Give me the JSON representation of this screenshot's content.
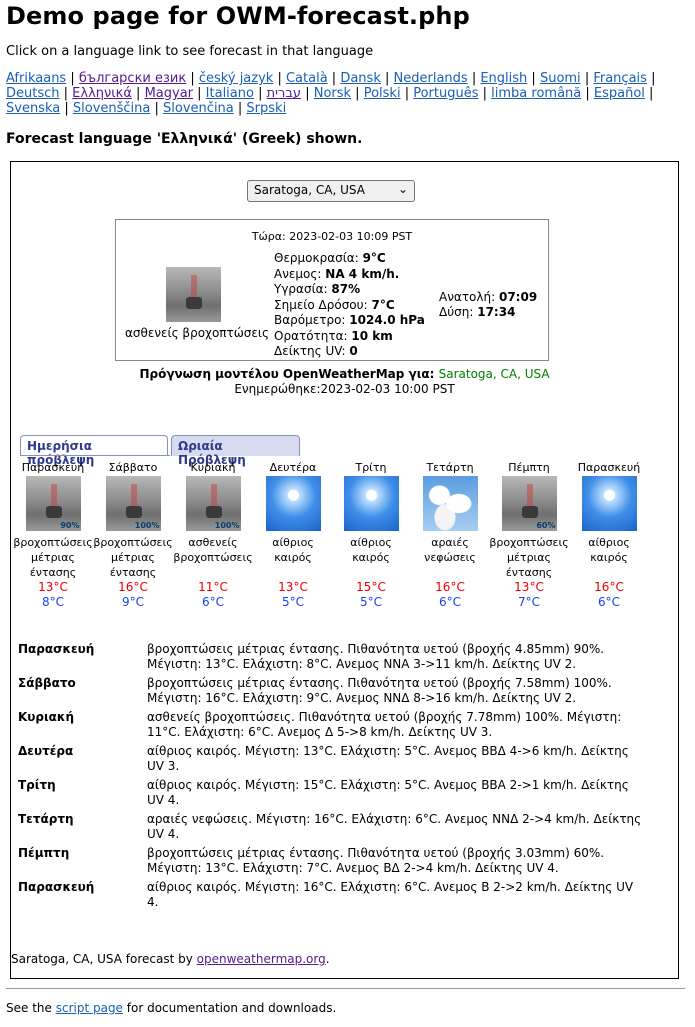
{
  "title": "Demo page for OWM-forecast.php",
  "intro": "Click on a language link to see forecast in that language",
  "languages": [
    "Afrikaans",
    "български език",
    "český jazyk",
    "Català",
    "Dansk",
    "Nederlands",
    "English",
    "Suomi",
    "Français",
    "Deutsch",
    "Ελληνικά",
    "Magyar",
    "Italiano",
    "עברית",
    "Norsk",
    "Polski",
    "Português",
    "limba română",
    "Español",
    "Svenska",
    "Slovenščina",
    "Slovenčina",
    "Srpski"
  ],
  "language_shown": "Forecast language 'Ελληνικά' (Greek) shown.",
  "location_select": "Saratoga, CA, USA",
  "current": {
    "now": "Τώρα: 2023-02-03 10:09 PST",
    "condition": "ασθενείς βροχοπτώσεις",
    "temp_label": "Θερμοκρασία:",
    "temp": "9°C",
    "wind_label": "Ανεμος:",
    "wind": "NA 4 km/h.",
    "humidity_label": "Υγρασία:",
    "humidity": "87%",
    "dew_label": "Σημείο Δρόσου:",
    "dew": "7°C",
    "baro_label": "Βαρόμετρο:",
    "baro": "1024.0 hPa",
    "vis_label": "Ορατότητα:",
    "vis": "10 km",
    "uv_label": "Δείκτης UV:",
    "uv": "0",
    "sunrise_label": "Ανατολή:",
    "sunrise": "07:09",
    "sunset_label": "Δύση:",
    "sunset": "17:34"
  },
  "forecast_label": "Πρόγνωση μοντέλου OpenWeatherMap για:",
  "forecast_location": "Saratoga, CA, USA",
  "updated": "Ενημερώθηκε:2023-02-03 10:00 PST",
  "tabs": [
    "Ημερήσια πρόβλεψη",
    "Ωριαία Πρόβλεψη"
  ],
  "days": [
    {
      "name": "Παρασκευή",
      "icon": "rain",
      "pop": "90%",
      "cond": "βροχοπτώσεις μέτριας έντασης",
      "hi": "13°C",
      "lo": "8°C"
    },
    {
      "name": "Σάββατο",
      "icon": "rain",
      "pop": "100%",
      "cond": "βροχοπτώσεις μέτριας έντασης",
      "hi": "16°C",
      "lo": "9°C"
    },
    {
      "name": "Κυριακή",
      "icon": "rain",
      "pop": "100%",
      "cond": "ασθενείς βροχοπτώσεις",
      "hi": "11°C",
      "lo": "6°C"
    },
    {
      "name": "Δευτέρα",
      "icon": "clear",
      "pop": "",
      "cond": "αίθριος καιρός",
      "hi": "13°C",
      "lo": "5°C"
    },
    {
      "name": "Τρίτη",
      "icon": "clear",
      "pop": "",
      "cond": "αίθριος καιρός",
      "hi": "15°C",
      "lo": "5°C"
    },
    {
      "name": "Τετάρτη",
      "icon": "clouds",
      "pop": "",
      "cond": "αραιές νεφώσεις",
      "hi": "16°C",
      "lo": "6°C"
    },
    {
      "name": "Πέμπτη",
      "icon": "rain",
      "pop": "60%",
      "cond": "βροχοπτώσεις μέτριας έντασης",
      "hi": "13°C",
      "lo": "7°C"
    },
    {
      "name": "Παρασκευή",
      "icon": "clear",
      "pop": "",
      "cond": "αίθριος καιρός",
      "hi": "16°C",
      "lo": "6°C"
    }
  ],
  "details": [
    {
      "day": "Παρασκευή",
      "text": "βροχοπτώσεις μέτριας έντασης. Πιθανότητα υετού (βροχής 4.85mm) 90%. Μέγιστη: 13°C. Ελάχιστη: 8°C. Ανεμος ΝΝΑ 3->11 km/h. Δείκτης UV 2."
    },
    {
      "day": "Σάββατο",
      "text": "βροχοπτώσεις μέτριας έντασης. Πιθανότητα υετού (βροχής 7.58mm) 100%. Μέγιστη: 16°C. Ελάχιστη: 9°C. Ανεμος ΝΝΔ 8->16 km/h. Δείκτης UV 2."
    },
    {
      "day": "Κυριακή",
      "text": "ασθενείς βροχοπτώσεις. Πιθανότητα υετού (βροχής 7.78mm) 100%. Μέγιστη: 11°C. Ελάχιστη: 6°C. Ανεμος Δ 5->8 km/h. Δείκτης UV 3."
    },
    {
      "day": "Δευτέρα",
      "text": "αίθριος καιρός. Μέγιστη: 13°C. Ελάχιστη: 5°C. Ανεμος ΒΒΔ 4->6 km/h. Δείκτης UV 3."
    },
    {
      "day": "Τρίτη",
      "text": "αίθριος καιρός. Μέγιστη: 15°C. Ελάχιστη: 5°C. Ανεμος ΒΒΑ 2->1 km/h. Δείκτης UV 4."
    },
    {
      "day": "Τετάρτη",
      "text": "αραιές νεφώσεις. Μέγιστη: 16°C. Ελάχιστη: 6°C. Ανεμος ΝΝΔ 2->4 km/h. Δείκτης UV 4."
    },
    {
      "day": "Πέμπτη",
      "text": "βροχοπτώσεις μέτριας έντασης. Πιθανότητα υετού (βροχής 3.03mm) 60%. Μέγιστη: 13°C. Ελάχιστη: 7°C. Ανεμος ΒΔ 2->4 km/h. Δείκτης UV 4."
    },
    {
      "day": "Παρασκευή",
      "text": "αίθριος καιρός. Μέγιστη: 16°C. Ελάχιστη: 6°C. Ανεμος Β 2->2 km/h. Δείκτης UV 4."
    }
  ],
  "credit_prefix": "Saratoga, CA, USA forecast by ",
  "credit_link": "openweathermap.org",
  "credit_suffix": ".",
  "footer_prefix": "See the ",
  "footer_link": "script page",
  "footer_suffix": " for documentation and downloads."
}
